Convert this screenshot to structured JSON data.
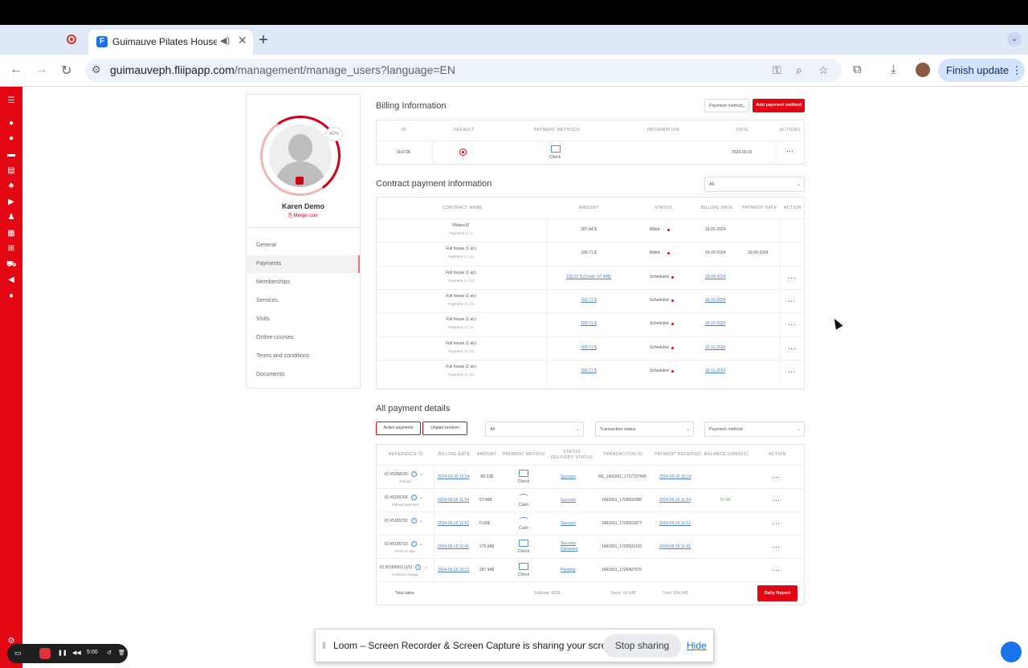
{
  "browser": {
    "tab_title": "Guimauve Pilates House",
    "url_host": "guimauveph.fliipapp.com",
    "url_path": "/management/manage_users?language=EN",
    "finish_update_label": "Finish update",
    "new_tab_glyph": "+",
    "close_glyph": "✕"
  },
  "profile": {
    "name": "Karen Demo",
    "merge_label": "Merge user",
    "progress_label": "40%",
    "progress_fraction": 0.4,
    "menu": [
      "General",
      "Payments",
      "Memberships",
      "Services",
      "Visits",
      "Online courses",
      "Terms and conditions",
      "Documents"
    ],
    "active_menu": "Payments"
  },
  "billing": {
    "title": "Billing Information",
    "payment_method_select": "Payment method",
    "add_button": "Add payment method",
    "headers": [
      "ID",
      "DEFAULT",
      "PAYMENT METHODS",
      "INFORMATION",
      "DATE",
      "ACTIONS"
    ],
    "row": {
      "id": "564724",
      "method": "Check",
      "date": "2024-09-16"
    }
  },
  "contract": {
    "title": "Contract payment information",
    "filter": "All",
    "headers": [
      "CONTRACT NAME",
      "AMOUNT",
      "STATUS",
      "BILLING DATE",
      "PAYMENT DATE",
      "ACTION"
    ],
    "rows": [
      {
        "name": "Pilates10",
        "payment": "Payment: 1 / 1",
        "amount": "287.44 $",
        "status": "Billed",
        "billing_date": "16-09-2024",
        "payment_date": "",
        "actions": false
      },
      {
        "name": "Full house (1 an)",
        "payment": "Payment: 1 / 12",
        "amount": "189.71 $",
        "status": "Billed",
        "billing_date": "16-09-2024",
        "payment_date": "16-09-2024",
        "actions": false
      },
      {
        "name": "Full house (1 an)",
        "payment": "Payment: 1 / 12",
        "amount": "132.22 $ (Credit -57.49$)",
        "status": "Scheduled",
        "billing_date": "16-09-2024",
        "payment_date": "",
        "actions": true
      },
      {
        "name": "Full house (1 an)",
        "payment": "Payment: 2 / 12",
        "amount": "189.71 $",
        "status": "Scheduled",
        "billing_date": "16-10-2024",
        "payment_date": "",
        "actions": true
      },
      {
        "name": "Full house (1 an)",
        "payment": "Payment: 2 / 12",
        "amount": "189.71 $",
        "status": "Scheduled",
        "billing_date": "16-10-2024",
        "payment_date": "",
        "actions": true
      },
      {
        "name": "Full house (1 an)",
        "payment": "Payment: 3 / 12",
        "amount": "189.71 $",
        "status": "Scheduled",
        "billing_date": "16-11-2024",
        "payment_date": "",
        "actions": true
      },
      {
        "name": "Full house (1 an)",
        "payment": "Payment: 3 / 12",
        "amount": "189.71 $",
        "status": "Scheduled",
        "billing_date": "16-11-2024",
        "payment_date": "",
        "actions": true
      }
    ]
  },
  "all_payments": {
    "title": "All payment details",
    "active_btn": "Active payments",
    "unpaid_btn": "Unpaid services",
    "filter_all": "All",
    "filter_status": "Transaction status",
    "filter_method": "Payment method",
    "headers": [
      "REFERENCE ID",
      "BILLING DATE",
      "AMOUNT",
      "PAYMENT METHOD",
      "STATUS",
      "DELIVERY STATUS",
      "TRANSACTION ID",
      "PAYMENT RECEIVED",
      "BALANCE (CREDIT)",
      "ACTION"
    ],
    "rows": [
      {
        "ref": "ID #5266530",
        "sub": "Refund",
        "date": "2024-09-30 16:24",
        "amount": "-86.23$",
        "method": "Check",
        "status": "Success",
        "delivery": "",
        "txn": "RE_1491651_1727727845",
        "received": "2024-09-30 16:24",
        "balance": ""
      },
      {
        "ref": "ID #5165764",
        "sub": "Manual payment",
        "date": "2024-09-16 11:54",
        "amount": "57.49$",
        "method": "Cash",
        "status": "Success",
        "delivery": "",
        "txn": "1491651_1726502086",
        "received": "2024-09-16 11:54",
        "balance": "57.49"
      },
      {
        "ref": "ID #5165752",
        "sub": "",
        "date": "2024-09-16 11:51",
        "amount": "0.00$",
        "method": "Cash",
        "status": "Success",
        "delivery": "",
        "txn": "1491651_1726501877",
        "received": "2024-09-16 11:51",
        "balance": ""
      },
      {
        "ref": "ID #5165710",
        "sub": "Point of sale",
        "date": "2024-09-16 11:41",
        "amount": "275.94$",
        "method": "Check",
        "status": "Success",
        "delivery": "Delivered",
        "txn": "1491651_1726501310",
        "received": "2024-09-16 11:41",
        "balance": ""
      },
      {
        "ref": "ID #5165501 (1/1)",
        "sub": "Contract change",
        "date": "2024-09-16 10:31",
        "amount": "287.44$",
        "method": "Check",
        "status": "Pending",
        "delivery": "",
        "txn": "1491651_1726497075",
        "received": "",
        "balance": ""
      }
    ],
    "footer": {
      "total_sales": "Total sales",
      "subtotal": "Subtotal: 465$",
      "taxes": "Taxes: 69.64$",
      "total": "Total: 534.64$",
      "daily_report": "Daily Report"
    }
  },
  "loom": {
    "timer": "5:00",
    "share_message": "Loom – Screen Recorder & Screen Capture is sharing your screen.",
    "stop_sharing": "Stop sharing",
    "hide": "Hide"
  },
  "colors": {
    "accent": "#e30613",
    "link": "#4a7fc1",
    "browser_tab_bg": "#dfe8f7"
  }
}
